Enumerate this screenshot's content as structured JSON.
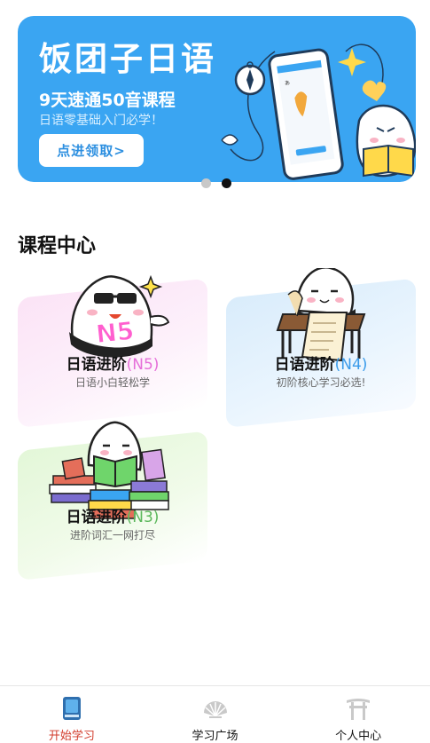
{
  "banner": {
    "title": "饭团子日语",
    "subtitle": "9天速通50音课程",
    "description": "日语零基础入门必学！",
    "cta_label": "点进领取>",
    "accent": "#3aa5f2"
  },
  "carousel": {
    "count": 2,
    "active_index": 1
  },
  "section": {
    "title": "课程中心"
  },
  "courses": [
    {
      "title": "日语进阶",
      "level": "(N5)",
      "level_color": "#e56fd9",
      "subtitle": "日语小白轻松学"
    },
    {
      "title": "日语进阶",
      "level": "(N4)",
      "level_color": "#3a9bea",
      "subtitle": "初阶核心学习必选!"
    },
    {
      "title": "日语进阶",
      "level": "(N3)",
      "level_color": "#5cb85c",
      "subtitle": "进阶词汇一网打尽"
    }
  ],
  "tabbar": {
    "items": [
      {
        "label": "开始学习",
        "icon": "book-icon",
        "active": true
      },
      {
        "label": "学习广场",
        "icon": "fan-icon",
        "active": false
      },
      {
        "label": "个人中心",
        "icon": "torii-gate-icon",
        "active": false
      }
    ],
    "active_color": "#d23c2c"
  }
}
